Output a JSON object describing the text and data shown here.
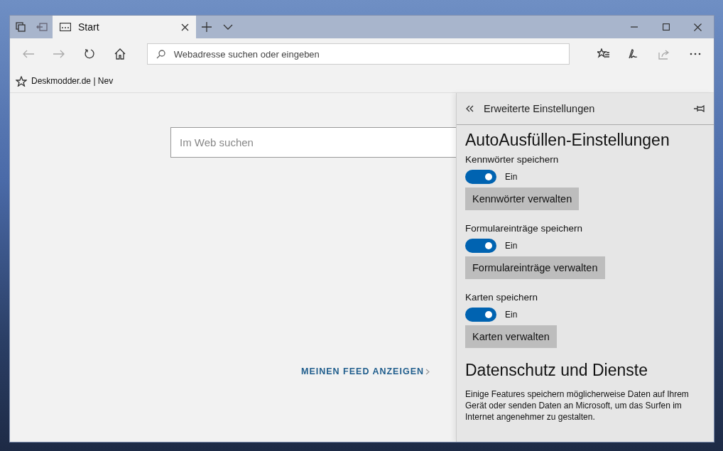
{
  "tabs": [
    {
      "title": "Start",
      "selected": true
    }
  ],
  "address_bar": {
    "placeholder": "Webadresse suchen oder eingeben"
  },
  "favorites": [
    {
      "label": "Deskmodder.de | Nev"
    }
  ],
  "page": {
    "search": {
      "placeholder": "Im Web suchen"
    },
    "feed_link": "MEINEN FEED ANZEIGEN"
  },
  "settings_panel": {
    "title": "Erweiterte Einstellungen",
    "sections": [
      {
        "heading": "AutoAusfüllen-Einstellungen",
        "items": [
          {
            "label": "Kennwörter speichern",
            "on": true,
            "state_text": "Ein",
            "button": "Kennwörter verwalten"
          },
          {
            "label": "Formulareinträge speichern",
            "on": true,
            "state_text": "Ein",
            "button": "Formulareinträge verwalten"
          },
          {
            "label": "Karten speichern",
            "on": true,
            "state_text": "Ein",
            "button": "Karten verwalten"
          }
        ]
      },
      {
        "heading": "Datenschutz und Dienste",
        "description": "Einige Features speichern möglicherweise Daten auf Ihrem Gerät oder senden Daten an Microsoft, um das Surfen im Internet angenehmer zu gestalten."
      }
    ]
  }
}
